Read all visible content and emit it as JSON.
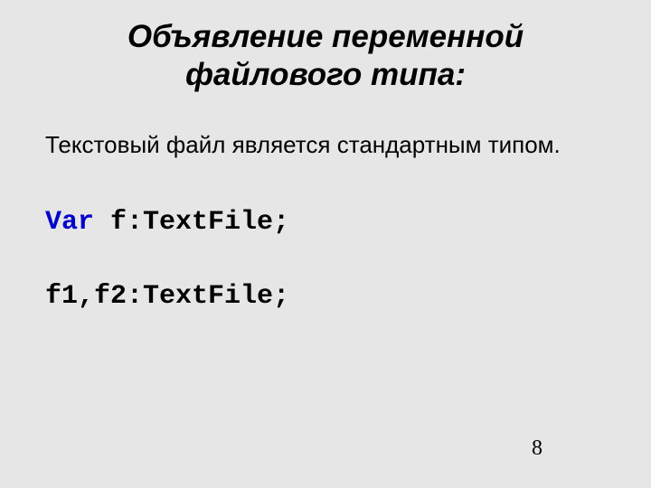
{
  "slide": {
    "title": "Объявление переменной файлового типа:",
    "body": "Текстовый файл является стандартным типом.",
    "code": {
      "keyword": "Var",
      "line1_rest": "   f:TextFile;",
      "line2": "      f1,f2:TextFile;"
    },
    "page_number": "8"
  }
}
